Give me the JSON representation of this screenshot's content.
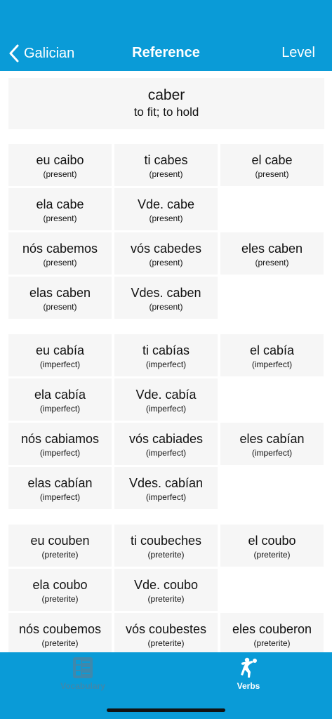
{
  "nav": {
    "back_label": "Galician",
    "title": "Reference",
    "right_label": "Level"
  },
  "verb": {
    "infinitive": "caber",
    "translation": "to fit; to hold"
  },
  "conjugations": [
    {
      "form": "eu caibo",
      "tense": "(present)"
    },
    {
      "form": "ti cabes",
      "tense": "(present)"
    },
    {
      "form": "el cabe",
      "tense": "(present)"
    },
    {
      "form": "ela cabe",
      "tense": "(present)"
    },
    {
      "form": "Vde. cabe",
      "tense": "(present)"
    },
    {
      "form": "nós cabemos",
      "tense": "(present)"
    },
    {
      "form": "vós cabedes",
      "tense": "(present)"
    },
    {
      "form": "eles caben",
      "tense": "(present)"
    },
    {
      "form": "elas caben",
      "tense": "(present)"
    },
    {
      "form": "Vdes. caben",
      "tense": "(present)"
    },
    {
      "form": "eu cabía",
      "tense": "(imperfect)"
    },
    {
      "form": "ti cabías",
      "tense": "(imperfect)"
    },
    {
      "form": "el cabía",
      "tense": "(imperfect)"
    },
    {
      "form": "ela cabía",
      "tense": "(imperfect)"
    },
    {
      "form": "Vde. cabía",
      "tense": "(imperfect)"
    },
    {
      "form": "nós cabiamos",
      "tense": "(imperfect)"
    },
    {
      "form": "vós cabiades",
      "tense": "(imperfect)"
    },
    {
      "form": "eles cabían",
      "tense": "(imperfect)"
    },
    {
      "form": "elas cabían",
      "tense": "(imperfect)"
    },
    {
      "form": "Vdes. cabían",
      "tense": "(imperfect)"
    },
    {
      "form": "eu couben",
      "tense": "(preterite)"
    },
    {
      "form": "ti coubeches",
      "tense": "(preterite)"
    },
    {
      "form": "el coubo",
      "tense": "(preterite)"
    },
    {
      "form": "ela coubo",
      "tense": "(preterite)"
    },
    {
      "form": "Vde. coubo",
      "tense": "(preterite)"
    },
    {
      "form": "nós coubemos",
      "tense": "(preterite)"
    },
    {
      "form": "vós coubestes",
      "tense": "(preterite)"
    },
    {
      "form": "eles couberon",
      "tense": "(preterite)"
    }
  ],
  "tabs": [
    {
      "label": "Vocabulary",
      "icon": "vocabulary-list-icon",
      "active": false
    },
    {
      "label": "Verbs",
      "icon": "discus-thrower-icon",
      "active": true
    }
  ],
  "colors": {
    "accent": "#0a9bd7",
    "cell_bg": "#f6f6f6",
    "inactive_tab": "#3f88ac"
  }
}
